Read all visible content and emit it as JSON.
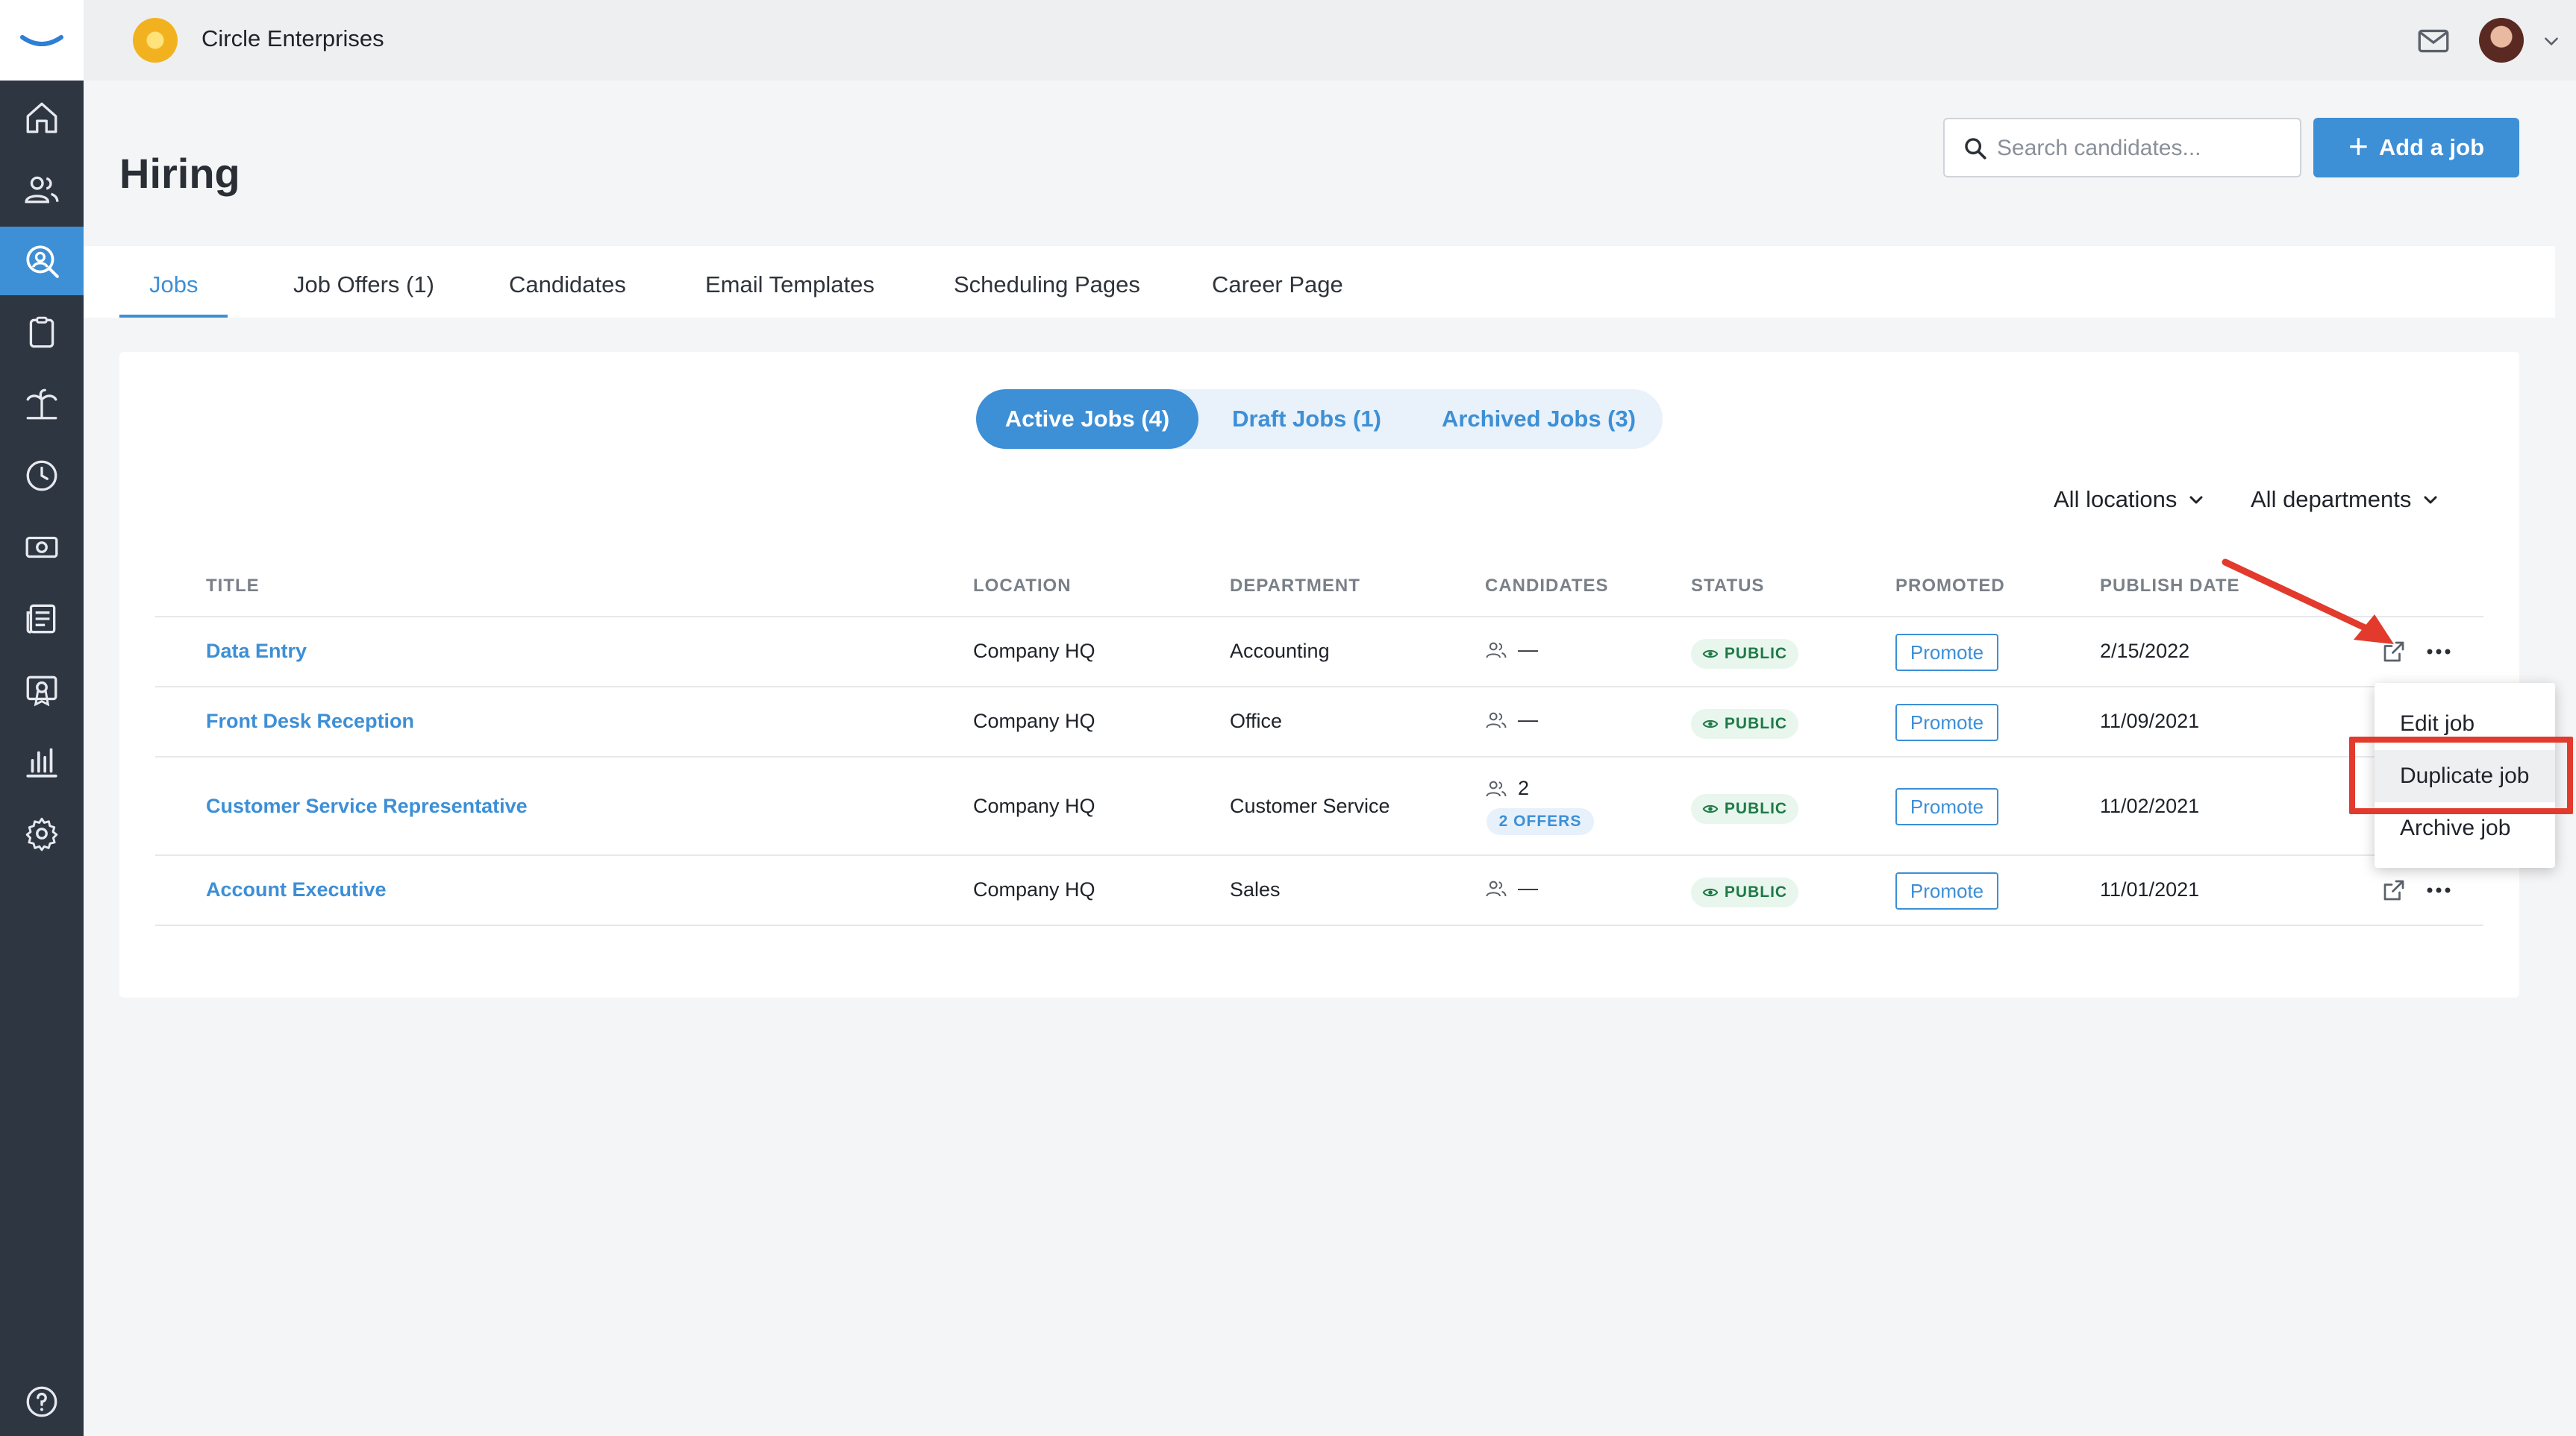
{
  "org": {
    "name": "Circle Enterprises"
  },
  "page": {
    "title": "Hiring"
  },
  "search": {
    "placeholder": "Search candidates..."
  },
  "actions": {
    "add_job_label": "Add a job"
  },
  "tabs": [
    {
      "label": "Jobs",
      "active": true
    },
    {
      "label": "Job Offers (1)"
    },
    {
      "label": "Candidates"
    },
    {
      "label": "Email Templates"
    },
    {
      "label": "Scheduling Pages"
    },
    {
      "label": "Career Page"
    }
  ],
  "segments": [
    {
      "label": "Active Jobs (4)",
      "active": true
    },
    {
      "label": "Draft Jobs (1)"
    },
    {
      "label": "Archived Jobs (3)"
    }
  ],
  "filters": {
    "locations": "All locations",
    "departments": "All departments"
  },
  "table": {
    "headers": [
      "TITLE",
      "LOCATION",
      "DEPARTMENT",
      "CANDIDATES",
      "STATUS",
      "PROMOTED",
      "PUBLISH DATE"
    ],
    "rows": [
      {
        "title": "Data Entry",
        "location": "Company HQ",
        "department": "Accounting",
        "candidates": "—",
        "status": "PUBLIC",
        "promote": "Promote",
        "publish_date": "2/15/2022"
      },
      {
        "title": "Front Desk Reception",
        "location": "Company HQ",
        "department": "Office",
        "candidates": "—",
        "status": "PUBLIC",
        "promote": "Promote",
        "publish_date": "11/09/2021"
      },
      {
        "title": "Customer Service Representative",
        "location": "Company HQ",
        "department": "Customer Service",
        "candidates": "2",
        "offers": "2 OFFERS",
        "status": "PUBLIC",
        "promote": "Promote",
        "publish_date": "11/02/2021"
      },
      {
        "title": "Account Executive",
        "location": "Company HQ",
        "department": "Sales",
        "candidates": "—",
        "status": "PUBLIC",
        "promote": "Promote",
        "publish_date": "11/01/2021"
      }
    ]
  },
  "menu": {
    "items": [
      "Edit job",
      "Duplicate job",
      "Archive job"
    ]
  },
  "colors": {
    "accent": "#3d8fd6",
    "sidebar": "#2e3642",
    "annotation": "#e23a2c",
    "status_public": "#1e7a45"
  },
  "sidebar_icons": [
    "home-icon",
    "people-icon",
    "hiring-icon",
    "clipboard-icon",
    "time-off-icon",
    "clock-icon",
    "payroll-icon",
    "news-icon",
    "training-icon",
    "reports-icon",
    "settings-icon",
    "help-icon"
  ]
}
